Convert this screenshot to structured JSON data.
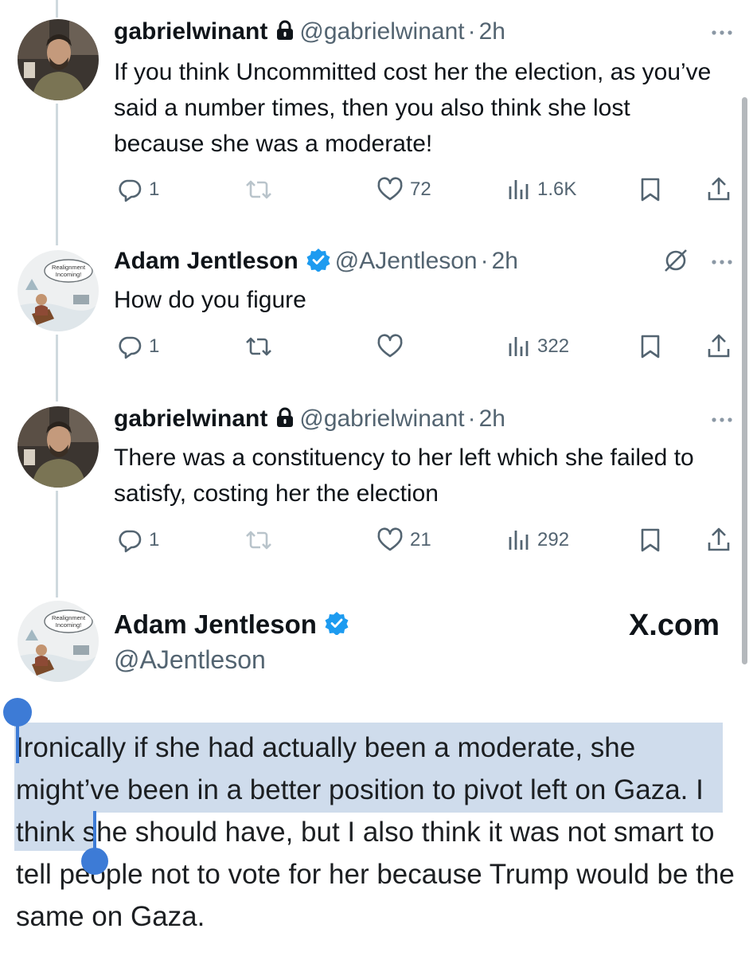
{
  "colors": {
    "accent": "#1d9bf0",
    "selection": "#cfdcec",
    "selection_handle": "#3d7bd6",
    "muted": "#536471"
  },
  "tweets": [
    {
      "name": "gabrielwinant",
      "handle": "@gabrielwinant",
      "sep": "·",
      "time": "2h",
      "badge": "lock-icon",
      "text": "If you think Uncommitted cost her the election, as you’ve said a number times, then you also think she lost because she was a moderate!",
      "replies": "1",
      "retweets": "",
      "likes": "72",
      "views": "1.6K"
    },
    {
      "name": "Adam Jentleson",
      "handle": "@AJentleson",
      "sep": "·",
      "time": "2h",
      "badge": "verified-icon",
      "text": "How do you figure",
      "replies": "1",
      "retweets": "",
      "likes": "",
      "views": "322"
    },
    {
      "name": "gabrielwinant",
      "handle": "@gabrielwinant",
      "sep": "·",
      "time": "2h",
      "badge": "lock-icon",
      "text": "There was a constituency to her left which she failed to satisfy, costing her the election",
      "replies": "1",
      "retweets": "",
      "likes": "21",
      "views": "292"
    }
  ],
  "main_tweet": {
    "name": "Adam Jentleson",
    "handle": "@AJentleson",
    "brand": "X.com",
    "avatar_caption_1": "Realignment",
    "avatar_caption_2": "Incoming!",
    "text_selected": "Ironically if she had actually been a moderate, she might’ve been in a better position to pivot left on Gaza.",
    "text_rest": " I think she should have, but I also think it was not smart to tell people not to vote for her because Trump would be the same on Gaza."
  }
}
